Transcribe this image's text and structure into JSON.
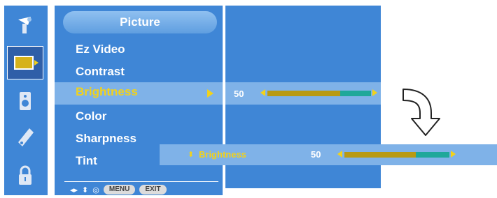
{
  "menu": {
    "title": "Picture",
    "items": [
      {
        "label": "Ez Video"
      },
      {
        "label": "Contrast"
      },
      {
        "label": "Brightness"
      },
      {
        "label": "Color"
      },
      {
        "label": "Sharpness"
      },
      {
        "label": "Tint"
      }
    ],
    "selected_index": 2
  },
  "hint_bar": {
    "nav_symbol": "◂▸",
    "updown_symbol": "⬍",
    "ok_symbol": "◎",
    "menu_label": "MENU",
    "exit_label": "EXIT"
  },
  "value_panel": {
    "brightness_value": "50",
    "brightness_level_percent": 70
  },
  "popup": {
    "updown_symbol": "⬍",
    "label": "Brightness",
    "value": "50",
    "level_percent": 68
  },
  "icons": {
    "sidebar": [
      "satellite-icon",
      "picture-icon",
      "audio-icon",
      "options-icon",
      "lock-icon"
    ],
    "selected_sidebar_index": 1
  },
  "colors": {
    "panel_blue": "#3f86d6",
    "highlight": "#7fb2e8",
    "accent_yellow": "#f2d21a",
    "bar_fill": "#b89a14",
    "bar_track": "#1fa89a"
  }
}
